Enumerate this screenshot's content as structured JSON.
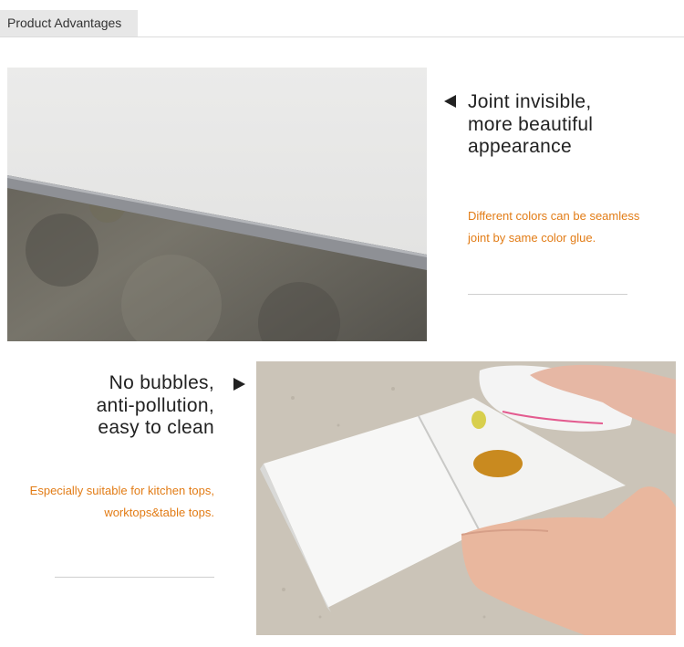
{
  "header": {
    "title": "Product Advantages"
  },
  "sections": [
    {
      "heading_lines": [
        "Joint invisible,",
        "more beautiful",
        "appearance"
      ],
      "description_lines": [
        "Different colors can be seamless",
        "joint by same color glue."
      ]
    },
    {
      "heading_lines": [
        "No bubbles,",
        "anti-pollution,",
        "easy to clean"
      ],
      "description_lines": [
        "Especially suitable for kitchen tops,",
        "worktops&table tops."
      ]
    }
  ],
  "colors": {
    "accent": "#e27c16",
    "heading": "#222222",
    "tab_bg": "#e7e7e7"
  },
  "icons": [
    "triangle-left-icon",
    "triangle-right-icon"
  ]
}
